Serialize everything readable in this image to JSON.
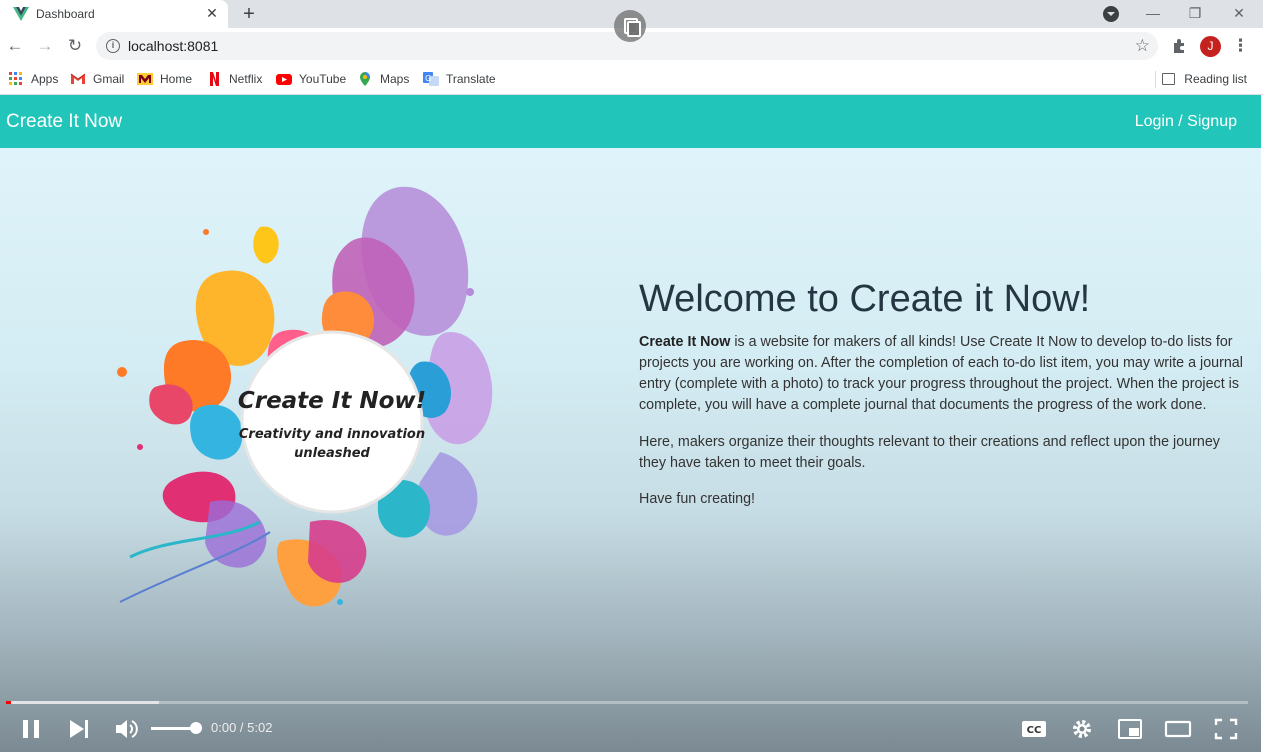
{
  "browser": {
    "tab_title": "Dashboard",
    "url": "localhost:8081",
    "avatar_initial": "J",
    "bookmarks": [
      {
        "label": "Apps",
        "icon": "apps-grid-icon"
      },
      {
        "label": "Gmail",
        "icon": "gmail-icon"
      },
      {
        "label": "Home",
        "icon": "home-m-icon"
      },
      {
        "label": "Netflix",
        "icon": "netflix-icon"
      },
      {
        "label": "YouTube",
        "icon": "youtube-icon"
      },
      {
        "label": "Maps",
        "icon": "maps-pin-icon"
      },
      {
        "label": "Translate",
        "icon": "translate-icon"
      }
    ],
    "reading_list": "Reading list"
  },
  "site": {
    "brand": "Create It Now",
    "login_link": "Login / Signup",
    "accent_color": "#21c5b9"
  },
  "hero": {
    "art_title": "Create It Now!",
    "art_tagline_1": "Creativity and innovation",
    "art_tagline_2": "unleashed",
    "heading": "Welcome to Create it Now!",
    "p1_bold": "Create It Now",
    "p1_rest": " is a website for makers of all kinds! Use Create It Now to develop to-do lists for projects you are working on. After the completion of each to-do list item, you may write a journal entry (complete with a photo) to track your progress throughout the project. When the project is complete, you will have a complete journal that documents the progress of the work done.",
    "p2": "Here, makers organize their thoughts relevant to their creations and reflect upon the journey they have taken to meet their goals.",
    "p3": "Have fun creating!"
  },
  "video": {
    "time": "0:00 / 5:02",
    "played_fraction": 0.004,
    "buffered_fraction": 0.123,
    "volume_fraction": 1.0
  }
}
